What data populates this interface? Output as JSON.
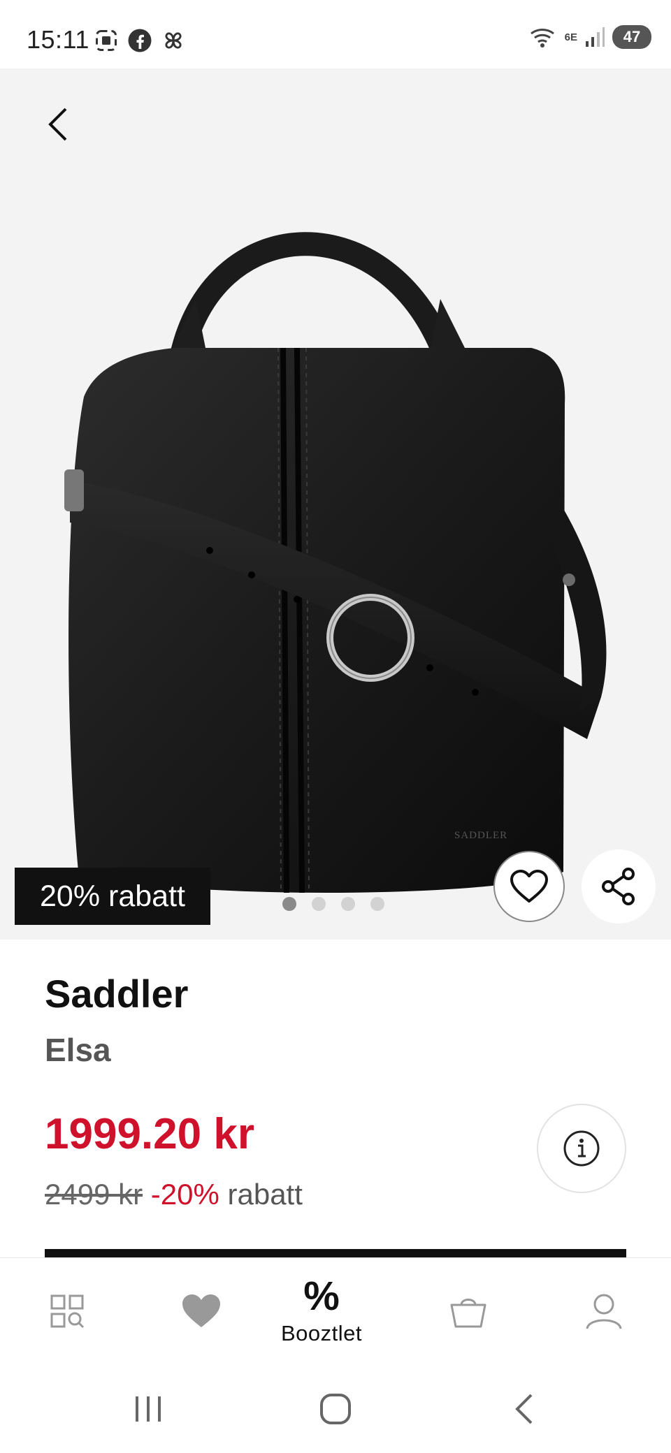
{
  "status_bar": {
    "time": "15:11",
    "network_label": "6E",
    "battery_level": "47",
    "left_icons": [
      "screenshot-icon",
      "facebook-icon",
      "pinwheel-icon"
    ],
    "right_icons": [
      "wifi-icon",
      "signal-icon",
      "battery-icon"
    ]
  },
  "product": {
    "badge": "20% rabatt",
    "brand": "Saddler",
    "name": "Elsa",
    "price": "1999.20 kr",
    "original_price": "2499 kr",
    "discount_text": "-20%",
    "discount_suffix": "rabatt",
    "image_logo_text": "SADDLER",
    "image_count": 4,
    "active_image": 0
  },
  "bottom_nav": {
    "items": [
      {
        "icon": "browse-categories-icon"
      },
      {
        "icon": "heart-icon"
      },
      {
        "icon": "percent-icon",
        "glyph": "%",
        "label": "Booztlet"
      },
      {
        "icon": "shopping-bag-icon"
      },
      {
        "icon": "user-icon"
      }
    ]
  },
  "colors": {
    "sale_red": "#d0112b",
    "badge_bg": "#111111",
    "image_bg": "#f3f3f3"
  }
}
